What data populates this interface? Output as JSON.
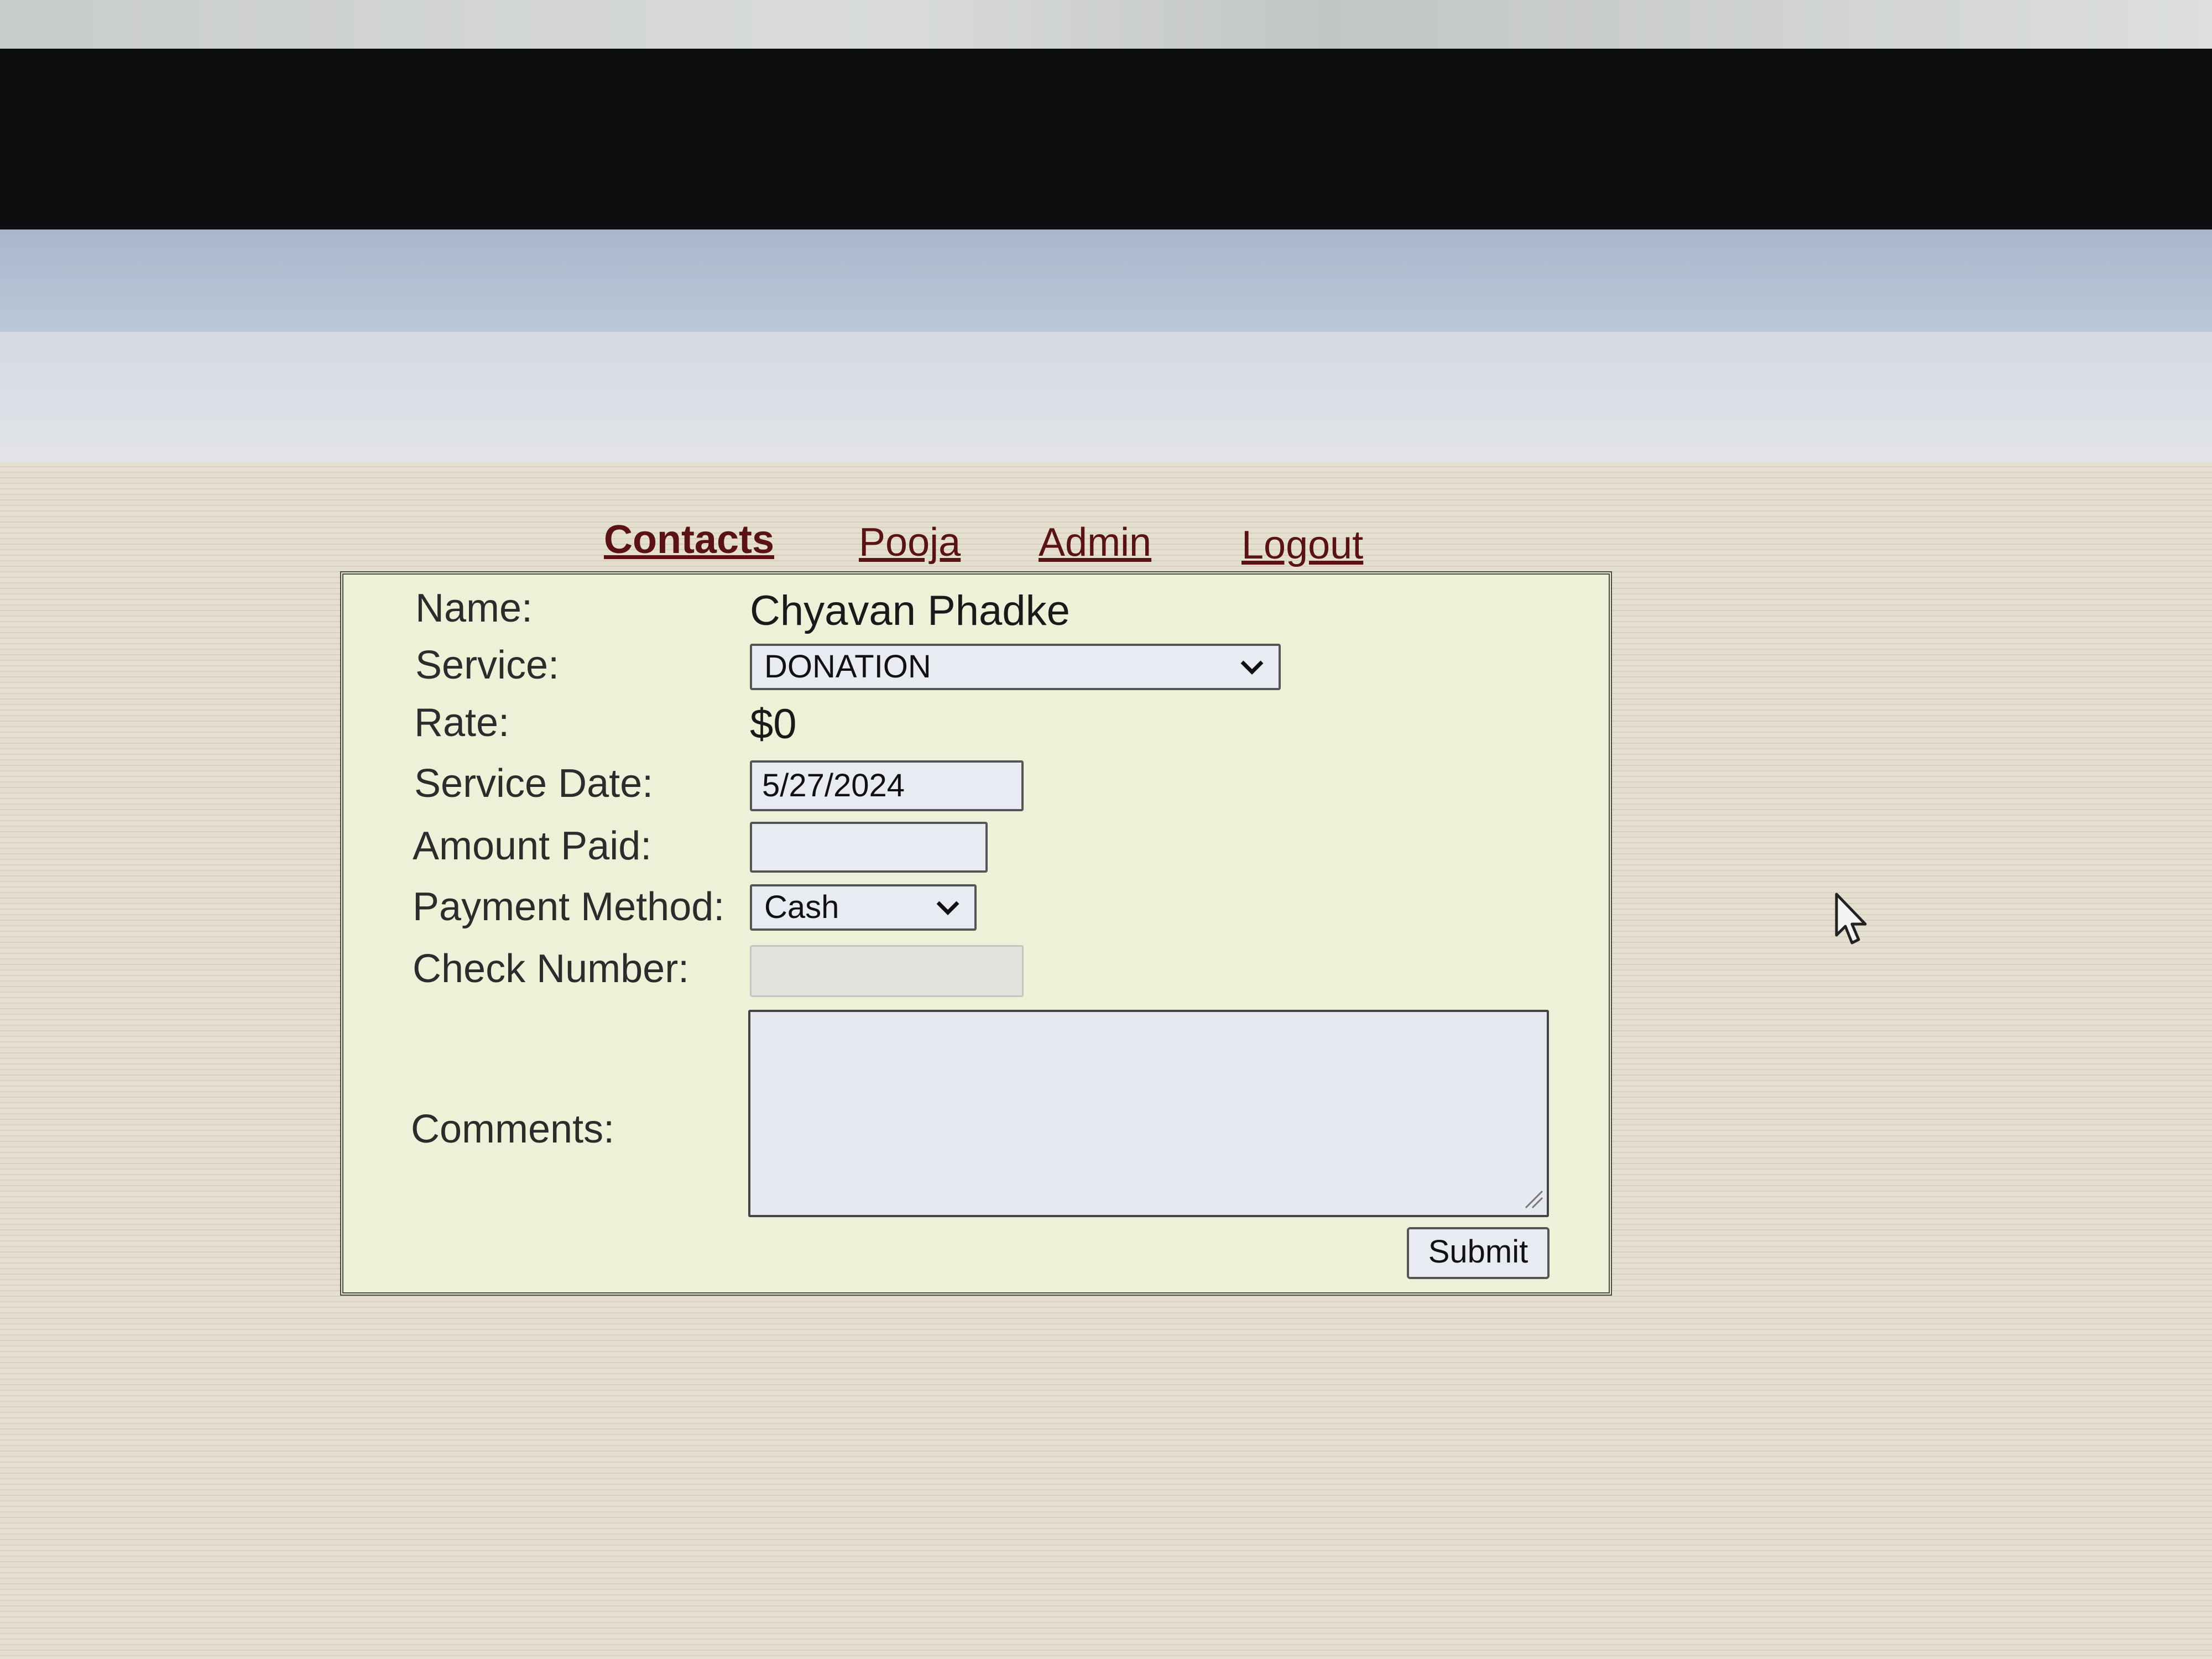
{
  "nav": {
    "contacts": "Contacts",
    "pooja": "Pooja",
    "admin": "Admin",
    "logout": "Logout"
  },
  "form": {
    "name_label": "Name:",
    "name_value": "Chyavan Phadke",
    "service_label": "Service:",
    "service_selected": "DONATION",
    "rate_label": "Rate:",
    "rate_value": "$0",
    "service_date_label": "Service Date:",
    "service_date_value": "5/27/2024",
    "amount_paid_label": "Amount Paid:",
    "amount_paid_value": "",
    "payment_method_label": "Payment Method:",
    "payment_method_selected": "Cash",
    "check_number_label": "Check Number:",
    "check_number_value": "",
    "comments_label": "Comments:",
    "comments_value": "",
    "submit_label": "Submit"
  },
  "colors": {
    "link": "#5a1212",
    "form_background": "#eef0d8",
    "page_background": "#e4dfcf",
    "header_band": "#aab6cb"
  },
  "icons": {
    "dropdown": "chevron-down-icon",
    "resize": "resize-grip-icon",
    "cursor": "mouse-pointer-icon"
  }
}
